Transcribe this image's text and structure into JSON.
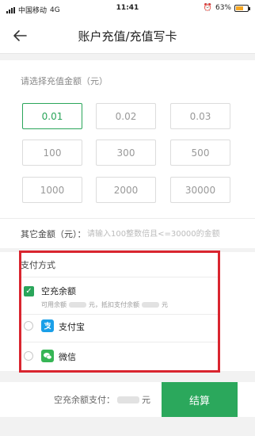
{
  "status_bar": {
    "carrier": "中国移动",
    "network": "4G",
    "time": "11:41",
    "battery": "63%",
    "battery_level": 0.63
  },
  "header": {
    "title": "账户充值/充值写卡"
  },
  "amount": {
    "section_label": "请选择充值金额（元）",
    "options": [
      "0.01",
      "0.02",
      "0.03",
      "100",
      "300",
      "500",
      "1000",
      "2000",
      "30000"
    ],
    "selected": "0.01"
  },
  "other_amount": {
    "label": "其它金额（元）：",
    "placeholder": "请输入100整数倍且<=30000的金额"
  },
  "payment": {
    "title": "支付方式",
    "options": [
      {
        "label": "空充余额",
        "sub_prefix": "可用余额",
        "sub_middle": "元，抵扣支付余额",
        "sub_suffix": "元",
        "checked": true
      },
      {
        "label": "支付宝",
        "icon": "alipay-icon",
        "checked": false
      },
      {
        "label": "微信",
        "icon": "wechat-icon",
        "checked": false
      }
    ]
  },
  "footer": {
    "total_label": "空充余额支付：",
    "unit": "元",
    "checkout_label": "结算"
  },
  "colors": {
    "accent": "#2aa55a",
    "highlight_border": "#d9252f"
  }
}
